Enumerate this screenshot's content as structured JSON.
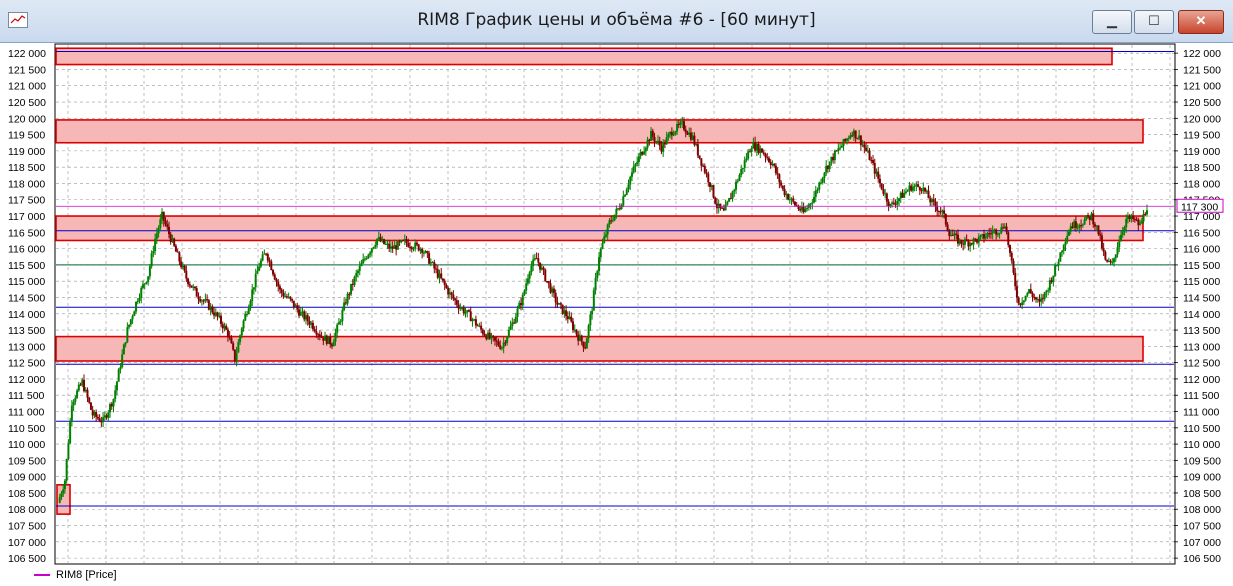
{
  "window": {
    "title": "RIM8 График цены и объёма #6 - [60 минут]",
    "buttons": {
      "minimize": "▁",
      "maximize": "☐",
      "close": "✕"
    }
  },
  "legend": {
    "label": "RIM8 [Price]",
    "color": "#cc00cc"
  },
  "chart_data": {
    "type": "candlestick",
    "title": "RIM8 График цены и объёма #6 - [60 минут]",
    "timeframe": "60 минут",
    "ylim": [
      106350,
      122250
    ],
    "y_ticks": [
      "122 000",
      "121 500",
      "121 000",
      "120 500",
      "120 000",
      "119 500",
      "119 000",
      "118 500",
      "118 000",
      "117 500",
      "117 000",
      "116 500",
      "116 000",
      "115 500",
      "115 000",
      "114 500",
      "114 000",
      "113 500",
      "113 000",
      "112 500",
      "112 000",
      "111 500",
      "111 000",
      "110 500",
      "110 000",
      "109 500",
      "109 000",
      "108 500",
      "108 000",
      "107 500",
      "107 000",
      "106 500"
    ],
    "grid": true,
    "up_color": "#008000",
    "down_color": "#800000",
    "last_price": {
      "value": 117300,
      "label": "117 300",
      "color": "#cc00cc"
    },
    "horizontal_levels": [
      {
        "value": 122050,
        "color": "#0000cc"
      },
      {
        "value": 116550,
        "color": "#0000cc"
      },
      {
        "value": 115500,
        "color": "#006633"
      },
      {
        "value": 114200,
        "color": "#0000cc"
      },
      {
        "value": 112450,
        "color": "#0000cc"
      },
      {
        "value": 110700,
        "color": "#0000cc"
      },
      {
        "value": 108100,
        "color": "#0000cc"
      }
    ],
    "zones": [
      {
        "from": 121650,
        "to": 122150,
        "span": "early-to-latest"
      },
      {
        "from": 119250,
        "to": 119950,
        "span": "full"
      },
      {
        "from": 116250,
        "to": 117000,
        "span": "full"
      },
      {
        "from": 112550,
        "to": 113300,
        "span": "full"
      },
      {
        "from": 107850,
        "to": 108750,
        "span": "first-bars"
      }
    ],
    "price_path": [
      [
        0,
        108200
      ],
      [
        4,
        108900
      ],
      [
        8,
        111300
      ],
      [
        14,
        111900
      ],
      [
        20,
        110900
      ],
      [
        26,
        110700
      ],
      [
        32,
        111400
      ],
      [
        40,
        113500
      ],
      [
        46,
        114500
      ],
      [
        52,
        115200
      ],
      [
        56,
        116300
      ],
      [
        60,
        117000
      ],
      [
        63,
        116600
      ],
      [
        68,
        115900
      ],
      [
        74,
        115100
      ],
      [
        80,
        114600
      ],
      [
        86,
        114300
      ],
      [
        92,
        113900
      ],
      [
        98,
        113400
      ],
      [
        102,
        112600
      ],
      [
        106,
        113600
      ],
      [
        110,
        114300
      ],
      [
        116,
        115500
      ],
      [
        120,
        115900
      ],
      [
        124,
        115300
      ],
      [
        128,
        114700
      ],
      [
        134,
        114400
      ],
      [
        140,
        114000
      ],
      [
        146,
        113700
      ],
      [
        152,
        113300
      ],
      [
        158,
        113100
      ],
      [
        162,
        113700
      ],
      [
        166,
        114400
      ],
      [
        172,
        115200
      ],
      [
        178,
        115800
      ],
      [
        184,
        116300
      ],
      [
        192,
        116000
      ],
      [
        200,
        116200
      ],
      [
        210,
        116000
      ],
      [
        218,
        115300
      ],
      [
        226,
        114600
      ],
      [
        232,
        114200
      ],
      [
        238,
        113900
      ],
      [
        244,
        113500
      ],
      [
        250,
        113200
      ],
      [
        256,
        113000
      ],
      [
        262,
        113700
      ],
      [
        268,
        114500
      ],
      [
        272,
        115400
      ],
      [
        276,
        115700
      ],
      [
        282,
        115000
      ],
      [
        288,
        114300
      ],
      [
        294,
        113900
      ],
      [
        300,
        113300
      ],
      [
        304,
        113000
      ],
      [
        308,
        114200
      ],
      [
        312,
        115800
      ],
      [
        318,
        116800
      ],
      [
        324,
        117300
      ],
      [
        330,
        118200
      ],
      [
        336,
        118900
      ],
      [
        342,
        119500
      ],
      [
        348,
        119100
      ],
      [
        354,
        119600
      ],
      [
        360,
        119800
      ],
      [
        366,
        119400
      ],
      [
        370,
        118800
      ],
      [
        376,
        118000
      ],
      [
        380,
        117300
      ],
      [
        384,
        117100
      ],
      [
        388,
        117600
      ],
      [
        394,
        118400
      ],
      [
        400,
        119200
      ],
      [
        406,
        119000
      ],
      [
        412,
        118600
      ],
      [
        418,
        117800
      ],
      [
        424,
        117400
      ],
      [
        430,
        117100
      ],
      [
        436,
        117600
      ],
      [
        442,
        118400
      ],
      [
        448,
        118900
      ],
      [
        454,
        119300
      ],
      [
        458,
        119600
      ],
      [
        462,
        119400
      ],
      [
        468,
        118800
      ],
      [
        474,
        118000
      ],
      [
        480,
        117300
      ],
      [
        486,
        117600
      ],
      [
        492,
        117900
      ],
      [
        498,
        117900
      ],
      [
        504,
        117400
      ],
      [
        510,
        117100
      ],
      [
        514,
        116500
      ],
      [
        520,
        116200
      ],
      [
        526,
        116200
      ],
      [
        532,
        116300
      ],
      [
        538,
        116500
      ],
      [
        544,
        116600
      ],
      [
        546,
        116800
      ],
      [
        550,
        115500
      ],
      [
        554,
        114300
      ],
      [
        560,
        114700
      ],
      [
        566,
        114300
      ],
      [
        570,
        114700
      ],
      [
        576,
        115500
      ],
      [
        580,
        116200
      ],
      [
        584,
        116700
      ],
      [
        590,
        116800
      ],
      [
        596,
        117000
      ],
      [
        600,
        116500
      ],
      [
        604,
        115600
      ],
      [
        608,
        115500
      ],
      [
        612,
        116300
      ],
      [
        616,
        116900
      ],
      [
        620,
        116900
      ],
      [
        624,
        116700
      ],
      [
        628,
        117300
      ]
    ],
    "annotations": []
  }
}
